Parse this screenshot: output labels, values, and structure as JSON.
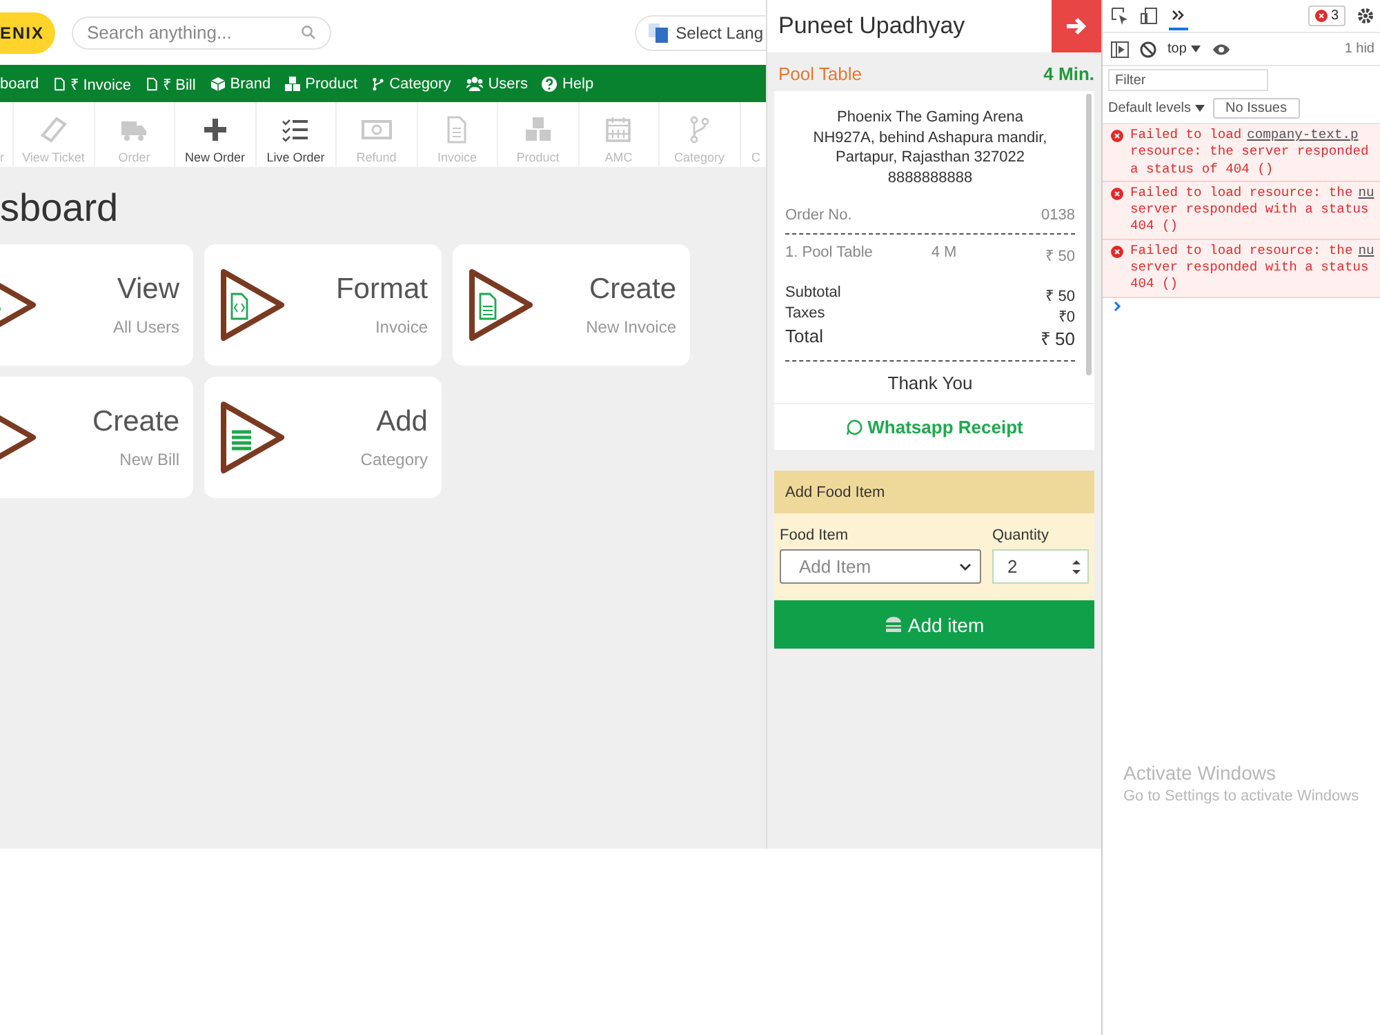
{
  "header": {
    "logo": "ENIX",
    "search": {
      "placeholder": "Search anything..."
    },
    "language_button": "Select Lang"
  },
  "nav": [
    {
      "kind": "none",
      "label": "board"
    },
    {
      "kind": "file",
      "label": "₹ Invoice"
    },
    {
      "kind": "file",
      "label": "₹ Bill"
    },
    {
      "kind": "cube",
      "label": "Brand"
    },
    {
      "kind": "cubes",
      "label": "Product"
    },
    {
      "kind": "branch",
      "label": "Category"
    },
    {
      "kind": "users",
      "label": "Users"
    },
    {
      "kind": "help",
      "label": "Help"
    }
  ],
  "toolbar": [
    {
      "kind": "partial",
      "label": "r",
      "disabled": true
    },
    {
      "kind": "ticket",
      "label": "View Ticket",
      "disabled": true
    },
    {
      "kind": "truck",
      "label": "Order",
      "disabled": true
    },
    {
      "kind": "plus",
      "label": "New Order",
      "disabled": false
    },
    {
      "kind": "checklist",
      "label": "Live Order",
      "disabled": false
    },
    {
      "kind": "money",
      "label": "Refund",
      "disabled": true
    },
    {
      "kind": "doc",
      "label": "Invoice",
      "disabled": true
    },
    {
      "kind": "cubes",
      "label": "Product",
      "disabled": true
    },
    {
      "kind": "calendar",
      "label": "AMC",
      "disabled": true
    },
    {
      "kind": "branch",
      "label": "Category",
      "disabled": true
    },
    {
      "kind": "partial",
      "label": "C",
      "disabled": true
    }
  ],
  "page_title": "sboard",
  "cards": [
    {
      "kind": "users",
      "title": "View",
      "subtitle": "All Users"
    },
    {
      "kind": "code",
      "title": "Format",
      "subtitle": "Invoice"
    },
    {
      "kind": "doc",
      "title": "Create",
      "subtitle": "New Invoice"
    },
    {
      "kind": "bill",
      "title": "Create",
      "subtitle": "New Bill"
    },
    {
      "kind": "list",
      "title": "Add",
      "subtitle": "Category"
    }
  ],
  "side_panel": {
    "customer": "Puneet Upadhyay",
    "table_name": "Pool Table",
    "duration": "4 Min.",
    "receipt": {
      "address": [
        "Phoenix The Gaming Arena",
        "NH927A, behind Ashapura mandir,",
        "Partapur, Rajasthan 327022",
        "8888888888"
      ],
      "order_label": "Order No.",
      "order_no": "0138",
      "items": [
        {
          "name": "1. Pool Table",
          "qty": "4 M",
          "price": "₹ 50"
        }
      ],
      "totals": [
        {
          "kind": "normal",
          "label": "Subtotal",
          "value": "₹ 50"
        },
        {
          "kind": "normal",
          "label": "Taxes",
          "value": "₹0"
        },
        {
          "kind": "grand",
          "label": "Total",
          "value": "₹ 50"
        }
      ],
      "footer": "Thank You"
    },
    "whatsapp_button": "Whatsapp Receipt",
    "food_form": {
      "title": "Add Food Item",
      "item_label": "Food Item",
      "item_placeholder": "Add Item",
      "qty_label": "Quantity",
      "qty_value": "2",
      "submit": "Add item"
    }
  },
  "devtools": {
    "error_count": "3",
    "context": "top",
    "hidden_count": "1 hid",
    "filter_placeholder": "Filter",
    "levels": "Default levels",
    "issues_button": "No Issues",
    "errors": [
      {
        "text": "Failed to load",
        "link": "company-text.p",
        "lines": [
          "resource: the server responded",
          "a status of 404 ()"
        ]
      },
      {
        "text": "Failed to load resource: the",
        "link": "nu",
        "lines": [
          "server responded with a status",
          "404 ()"
        ]
      },
      {
        "text": "Failed to load resource: the",
        "link": "nu",
        "lines": [
          "server responded with a status",
          "404 ()"
        ]
      }
    ]
  },
  "os_notice": {
    "title": "Activate Windows",
    "text": "Go to Settings to activate Windows"
  }
}
